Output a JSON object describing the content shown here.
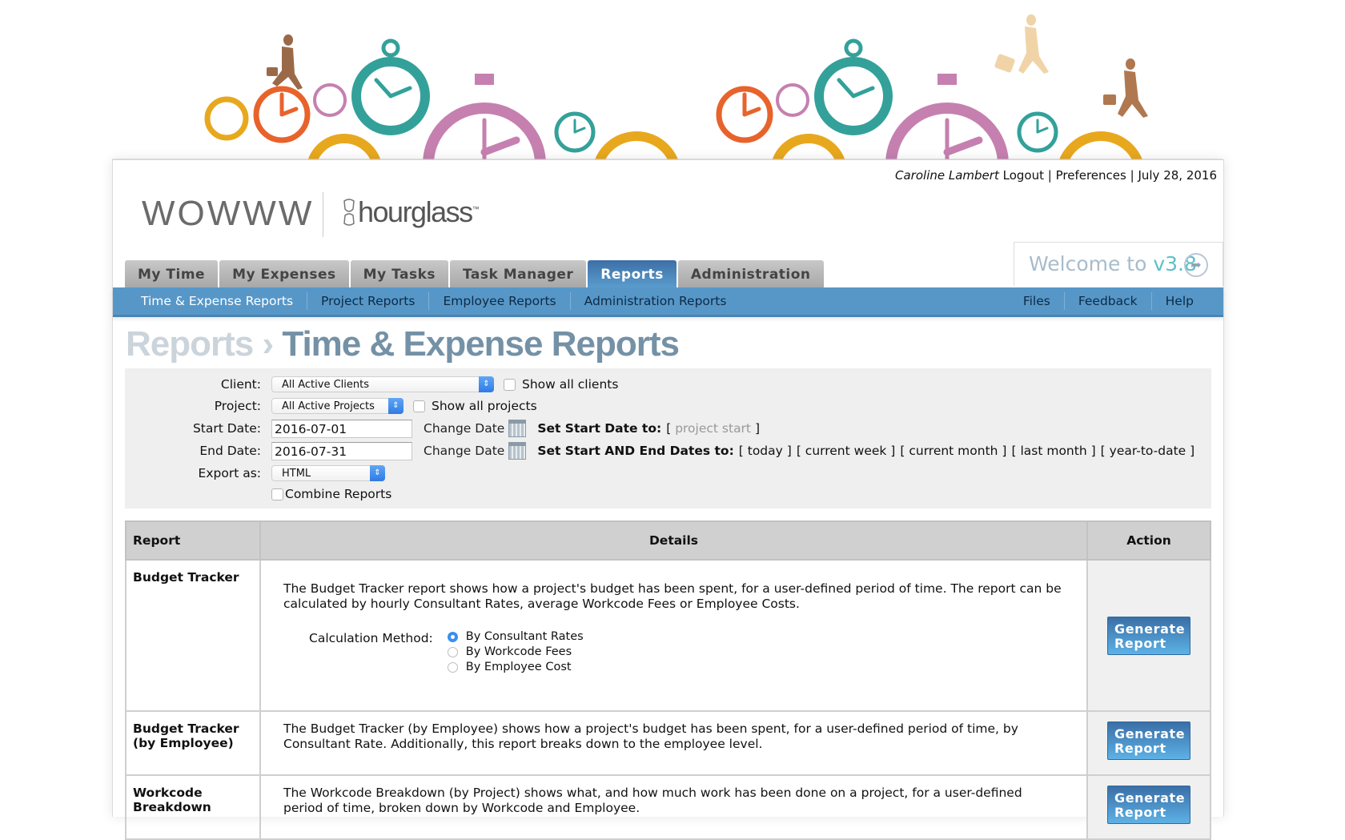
{
  "user": {
    "name": "Caroline Lambert",
    "logout": "Logout",
    "preferences": "Preferences",
    "date": "July 28, 2016",
    "separator": "|"
  },
  "brand": {
    "company": "WOWWW",
    "product": "hourglass",
    "product_mark": "™"
  },
  "welcome": {
    "prefix": "Welcome to ",
    "version": "v3.8",
    "icon": "arrow-circle-icon"
  },
  "tabs": [
    {
      "label": "My Time",
      "active": false
    },
    {
      "label": "My Expenses",
      "active": false
    },
    {
      "label": "My Tasks",
      "active": false
    },
    {
      "label": "Task Manager",
      "active": false
    },
    {
      "label": "Reports",
      "active": true
    },
    {
      "label": "Administration",
      "active": false
    }
  ],
  "subnav": {
    "left": [
      "Time & Expense Reports",
      "Project Reports",
      "Employee Reports",
      "Administration Reports"
    ],
    "right": [
      "Files",
      "Feedback",
      "Help"
    ],
    "active": "Time & Expense Reports"
  },
  "page_title": {
    "crumb": "Reports",
    "separator": "›",
    "current": "Time & Expense Reports"
  },
  "filters": {
    "client": {
      "label": "Client:",
      "value": "All Active Clients",
      "checkbox": "Show all clients",
      "checked": false
    },
    "project": {
      "label": "Project:",
      "value": "All Active Projects",
      "checkbox": "Show all projects",
      "checked": false
    },
    "start_date": {
      "label": "Start Date:",
      "value": "2016-07-01",
      "change": "Change Date"
    },
    "end_date": {
      "label": "End Date:",
      "value": "2016-07-31",
      "change": "Change Date"
    },
    "set_start": {
      "label": "Set Start Date to:",
      "options": [
        "project start"
      ]
    },
    "set_both": {
      "label": "Set Start AND End Dates to:",
      "options": [
        "today",
        "current week",
        "current month",
        "last month",
        "year-to-date"
      ]
    },
    "export": {
      "label": "Export as:",
      "value": "HTML"
    },
    "combine": {
      "label": "Combine Reports",
      "checked": false
    }
  },
  "table": {
    "headers": [
      "Report",
      "Details",
      "Action"
    ],
    "rows": [
      {
        "name": "Budget Tracker",
        "details": "The Budget Tracker report shows how a project's budget has been spent, for a user-defined period of time. The report can be calculated by hourly Consultant Rates, average Workcode Fees or Employee Costs.",
        "calc_label": "Calculation Method:",
        "methods": [
          {
            "label": "By Consultant Rates",
            "selected": true
          },
          {
            "label": "By Workcode Fees",
            "selected": false
          },
          {
            "label": "By Employee Cost",
            "selected": false
          }
        ],
        "action": "Generate Report"
      },
      {
        "name": "Budget Tracker (by Employee)",
        "details": "The Budget Tracker (by Employee) shows how a project's budget has been spent, for a user-defined period of time, by Consultant Rate. Additionally, this report breaks down to the employee level.",
        "action": "Generate Report"
      },
      {
        "name": "Workcode Breakdown",
        "details": "The Workcode Breakdown (by Project) shows what, and how much work has been done on a project, for a user-defined period of time, broken down by Workcode and Employee.",
        "action": "Generate Report"
      }
    ]
  }
}
